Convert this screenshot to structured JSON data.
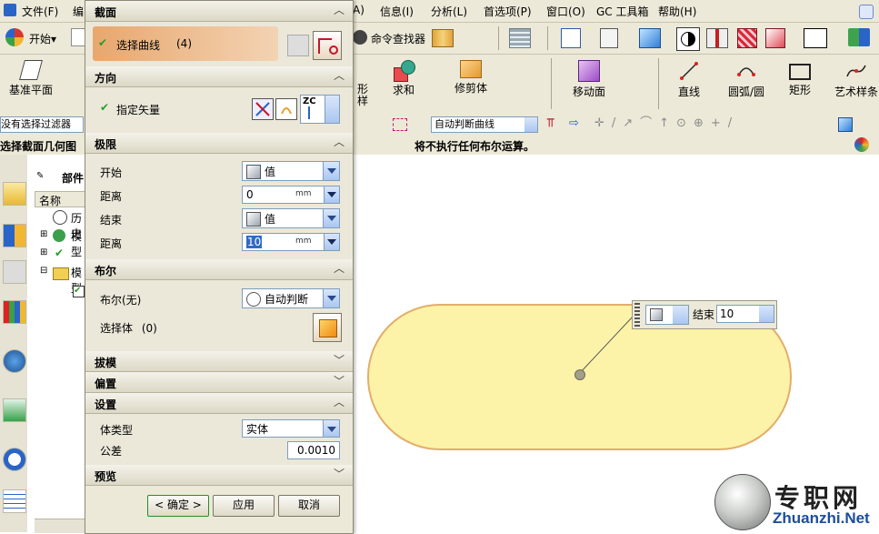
{
  "menubar": {
    "left_items": [
      "文件(F)",
      "编"
    ],
    "right_items": [
      "A)",
      "信息(I)",
      "分析(L)",
      "首选项(P)",
      "窗口(O)",
      "GC 工具箱",
      "帮助(H)"
    ]
  },
  "toolbar1": {
    "start_label": "开始▾",
    "command_finder": "命令查找器"
  },
  "toolbar2": {
    "datum_plane": "基准平面",
    "extrude_partial": "形",
    "extrude_partial2": "样",
    "unite": "求和",
    "trim_body": "修剪体",
    "move_face": "移动面",
    "line": "直线",
    "arc": "圆弧/圆",
    "rectangle": "矩形",
    "studio_spline": "艺术样条"
  },
  "toolbar3": {
    "filter_text": "没有选择过滤器",
    "curve_rule": "自动判断曲线"
  },
  "statusbar": {
    "left_text": "选择截面几何图",
    "message": "将不执行任何布尔运算。"
  },
  "navigator": {
    "title": "部件",
    "column_name": "名称",
    "items": [
      "历史",
      "模型",
      "模型"
    ]
  },
  "dialog": {
    "section": {
      "title": "截面",
      "select_curve": "选择曲线",
      "count": "(4)"
    },
    "direction": {
      "title": "方向",
      "specify_vector": "指定矢量",
      "vector_label": "ZC"
    },
    "limits": {
      "title": "极限",
      "start_label": "开始",
      "start_option": "值",
      "distance1_label": "距离",
      "distance1_value": "0",
      "distance1_unit": "mm",
      "end_label": "结束",
      "end_option": "值",
      "distance2_label": "距离",
      "distance2_value": "10",
      "distance2_unit": "mm"
    },
    "boolean": {
      "title": "布尔",
      "boolean_label": "布尔(无)",
      "boolean_option": "自动判断",
      "select_body": "选择体",
      "select_body_count": "(0)"
    },
    "draft": {
      "title": "拔模"
    },
    "offset": {
      "title": "偏置"
    },
    "settings": {
      "title": "设置",
      "body_type_label": "体类型",
      "body_type_option": "实体",
      "tolerance_label": "公差",
      "tolerance_value": "0.0010"
    },
    "preview": {
      "title": "预览"
    },
    "buttons": {
      "ok": "< 确定 >",
      "apply": "应用",
      "cancel": "取消"
    }
  },
  "onscreen_input": {
    "label": "结束",
    "value": "10"
  },
  "watermark": {
    "brand": "专职网",
    "url": "Zhuanzhi.Net"
  },
  "colors": {
    "chrome": "#ece9d8",
    "slot_fill": "#fdf3a8",
    "slot_edge": "#e4ad69",
    "selected_highlight": "#e8a76e",
    "check_green": "#2a9b2a"
  }
}
